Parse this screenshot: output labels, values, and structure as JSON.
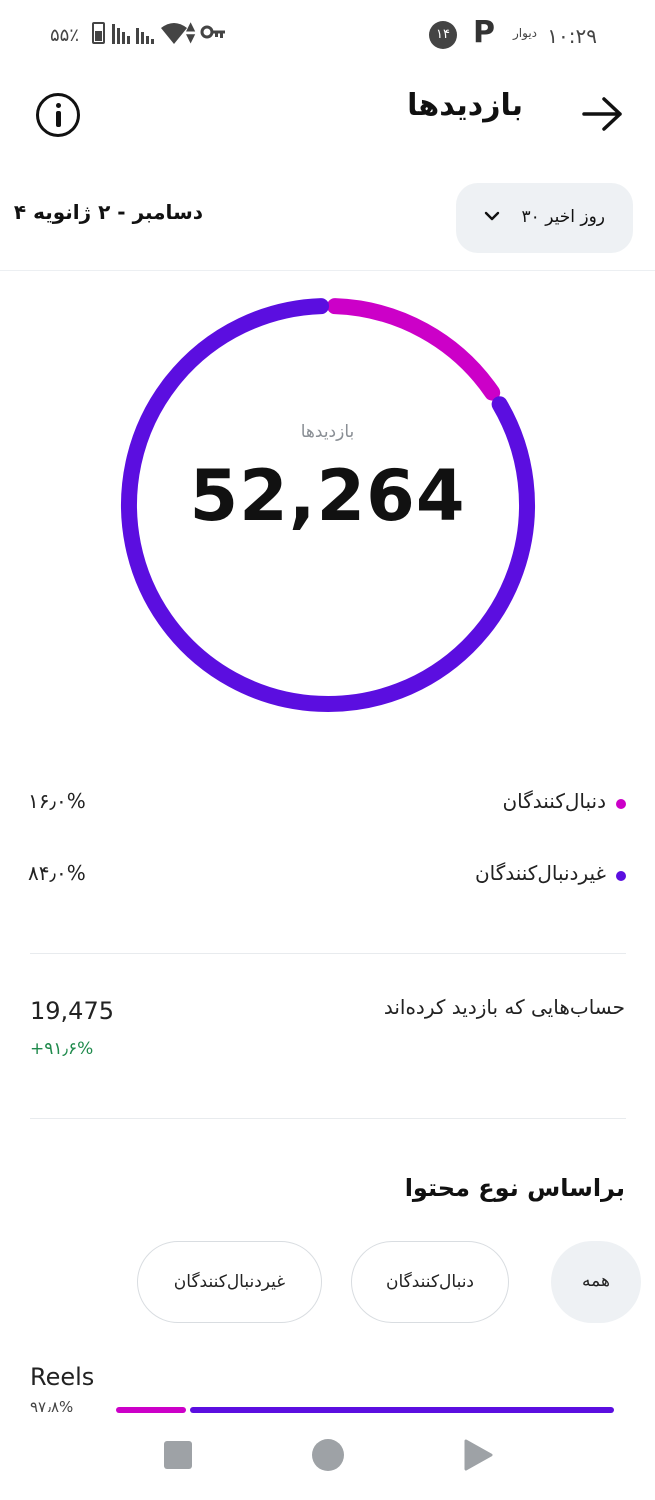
{
  "status_bar": {
    "time": "۱۰:۲۹",
    "app_label": "دیوار",
    "notification_count": "۱۴",
    "p_glyph": "P",
    "battery_percent": "۵۵٪"
  },
  "header": {
    "title": "بازدیدها"
  },
  "date_row": {
    "range_option": "۳۰ روز اخیر",
    "date_range": "۴ دسامبر - ۲ ژانویه"
  },
  "summary": {
    "label": "بازدیدها",
    "total": "52,264"
  },
  "chart_data": {
    "type": "pie",
    "categories": [
      "دنبال‌کنندگان",
      "غیردنبال‌کنندگان"
    ],
    "values": [
      16.0,
      84.0
    ],
    "colors": [
      "#cc00c8",
      "#5b0ee0"
    ]
  },
  "legend": [
    {
      "label": "دنبال‌کنندگان",
      "percent": "۱۶٫۰%",
      "color": "#cc00c8"
    },
    {
      "label": "غیردنبال‌کنندگان",
      "percent": "۸۴٫۰%",
      "color": "#5b0ee0"
    }
  ],
  "accounts": {
    "label": "حساب‌هایی که بازدید کرده‌اند",
    "value": "19,475",
    "change": "+۹۱٫۶%"
  },
  "content_type": {
    "title": "براساس نوع محتوا",
    "chips": {
      "all": "همه",
      "followers": "دنبال‌کنندگان",
      "non_followers": "غیردنبال‌کنندگان"
    },
    "reels": {
      "label": "Reels",
      "percent": "۹۷٫۸%"
    }
  },
  "colors": {
    "followers": "#cc00c8",
    "non_followers": "#5b0ee0",
    "positive": "#1f8a4c"
  },
  "icons": {
    "back": "arrow-right-icon",
    "info": "info-icon",
    "dropdown": "chevron-down-icon"
  }
}
